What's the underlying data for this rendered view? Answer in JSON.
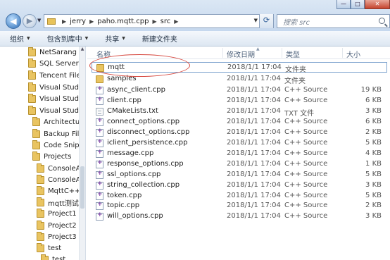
{
  "window": {
    "controls": {
      "minimize": "—",
      "maximize": "□",
      "close": "✕"
    }
  },
  "address": {
    "segments": [
      "jerry",
      "paho.mqtt.cpp",
      "src"
    ],
    "dropdown_icon": "chevron-down-icon",
    "refresh_icon": "refresh-icon"
  },
  "search": {
    "placeholder": "搜索 src"
  },
  "toolbar": {
    "organize": "组织",
    "include_in_library": "包含到库中",
    "share": "共享",
    "new_folder": "新建文件夹"
  },
  "sidebar": {
    "items": [
      {
        "label": "NetSarang",
        "icon": "folder-icon"
      },
      {
        "label": "SQL Server M",
        "icon": "folder-icon"
      },
      {
        "label": "Tencent Files",
        "icon": "folder-icon"
      },
      {
        "label": "Visual Studio",
        "icon": "folder-icon"
      },
      {
        "label": "Visual Studio",
        "icon": "folder-icon"
      },
      {
        "label": "Visual Studio",
        "icon": "folder-icon"
      },
      {
        "label": "Architecture",
        "icon": "folder-icon"
      },
      {
        "label": "Backup Files",
        "icon": "folder-icon"
      },
      {
        "label": "Code Snipp",
        "icon": "folder-icon"
      },
      {
        "label": "Projects",
        "icon": "folder-icon"
      },
      {
        "label": "ConsoleAp",
        "icon": "folder-icon"
      },
      {
        "label": "ConsoleAp",
        "icon": "folder-icon"
      },
      {
        "label": "MqttC++",
        "icon": "folder-icon"
      },
      {
        "label": "mqtt测试",
        "icon": "folder-icon"
      },
      {
        "label": "Project1",
        "icon": "folder-icon"
      },
      {
        "label": "Project2",
        "icon": "folder-icon"
      },
      {
        "label": "Project3",
        "icon": "folder-icon"
      },
      {
        "label": "test",
        "icon": "folder-icon"
      },
      {
        "label": "test",
        "icon": "folder-icon"
      }
    ]
  },
  "columns": {
    "name": "名称",
    "date": "修改日期",
    "type": "类型",
    "size": "大小"
  },
  "files": [
    {
      "name": "mqtt",
      "date": "2018/1/1 17:04",
      "type": "文件夹",
      "size": "",
      "icon": "folder-icon"
    },
    {
      "name": "samples",
      "date": "2018/1/1 17:04",
      "type": "文件夹",
      "size": "",
      "icon": "folder-icon"
    },
    {
      "name": "async_client.cpp",
      "date": "2018/1/1 17:04",
      "type": "C++ Source",
      "size": "19 KB",
      "icon": "cpp-file-icon"
    },
    {
      "name": "client.cpp",
      "date": "2018/1/1 17:04",
      "type": "C++ Source",
      "size": "6 KB",
      "icon": "cpp-file-icon"
    },
    {
      "name": "CMakeLists.txt",
      "date": "2018/1/1 17:04",
      "type": "TXT 文件",
      "size": "3 KB",
      "icon": "text-file-icon"
    },
    {
      "name": "connect_options.cpp",
      "date": "2018/1/1 17:04",
      "type": "C++ Source",
      "size": "6 KB",
      "icon": "cpp-file-icon"
    },
    {
      "name": "disconnect_options.cpp",
      "date": "2018/1/1 17:04",
      "type": "C++ Source",
      "size": "2 KB",
      "icon": "cpp-file-icon"
    },
    {
      "name": "iclient_persistence.cpp",
      "date": "2018/1/1 17:04",
      "type": "C++ Source",
      "size": "5 KB",
      "icon": "cpp-file-icon"
    },
    {
      "name": "message.cpp",
      "date": "2018/1/1 17:04",
      "type": "C++ Source",
      "size": "4 KB",
      "icon": "cpp-file-icon"
    },
    {
      "name": "response_options.cpp",
      "date": "2018/1/1 17:04",
      "type": "C++ Source",
      "size": "1 KB",
      "icon": "cpp-file-icon"
    },
    {
      "name": "ssl_options.cpp",
      "date": "2018/1/1 17:04",
      "type": "C++ Source",
      "size": "5 KB",
      "icon": "cpp-file-icon"
    },
    {
      "name": "string_collection.cpp",
      "date": "2018/1/1 17:04",
      "type": "C++ Source",
      "size": "3 KB",
      "icon": "cpp-file-icon"
    },
    {
      "name": "token.cpp",
      "date": "2018/1/1 17:04",
      "type": "C++ Source",
      "size": "5 KB",
      "icon": "cpp-file-icon"
    },
    {
      "name": "topic.cpp",
      "date": "2018/1/1 17:04",
      "type": "C++ Source",
      "size": "2 KB",
      "icon": "cpp-file-icon"
    },
    {
      "name": "will_options.cpp",
      "date": "2018/1/1 17:04",
      "type": "C++ Source",
      "size": "3 KB",
      "icon": "cpp-file-icon"
    }
  ],
  "highlight_color": "#d6463d"
}
